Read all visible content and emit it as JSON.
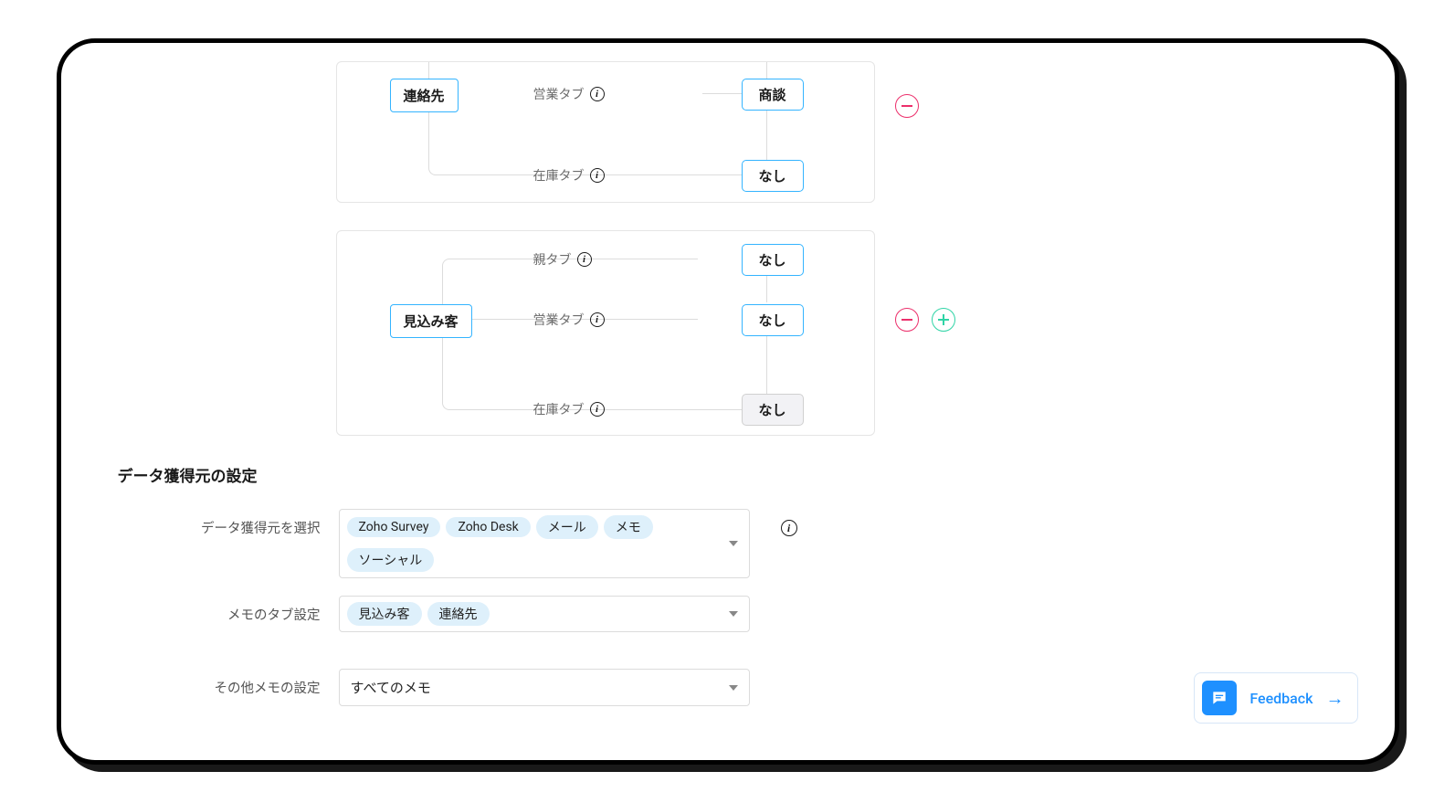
{
  "cards": [
    {
      "module": "連絡先",
      "rows": [
        {
          "label": "営業タブ",
          "value": "商談",
          "muted": false
        },
        {
          "label": "在庫タブ",
          "value": "なし",
          "muted": false
        }
      ],
      "actions": {
        "remove": true,
        "add": false
      }
    },
    {
      "module": "見込み客",
      "rows": [
        {
          "label": "親タブ",
          "value": "なし",
          "muted": false
        },
        {
          "label": "営業タブ",
          "value": "なし",
          "muted": false
        },
        {
          "label": "在庫タブ",
          "value": "なし",
          "muted": true
        }
      ],
      "actions": {
        "remove": true,
        "add": true
      }
    }
  ],
  "section_heading": "データ獲得元の設定",
  "form": {
    "source": {
      "label": "データ獲得元を選択",
      "chips": [
        "Zoho Survey",
        "Zoho Desk",
        "メール",
        "メモ",
        "ソーシャル"
      ]
    },
    "memo_tabs": {
      "label": "メモのタブ設定",
      "chips": [
        "見込み客",
        "連絡先"
      ]
    },
    "other_memo": {
      "label": "その他メモの設定",
      "value": "すべてのメモ"
    }
  },
  "feedback_label": "Feedback"
}
